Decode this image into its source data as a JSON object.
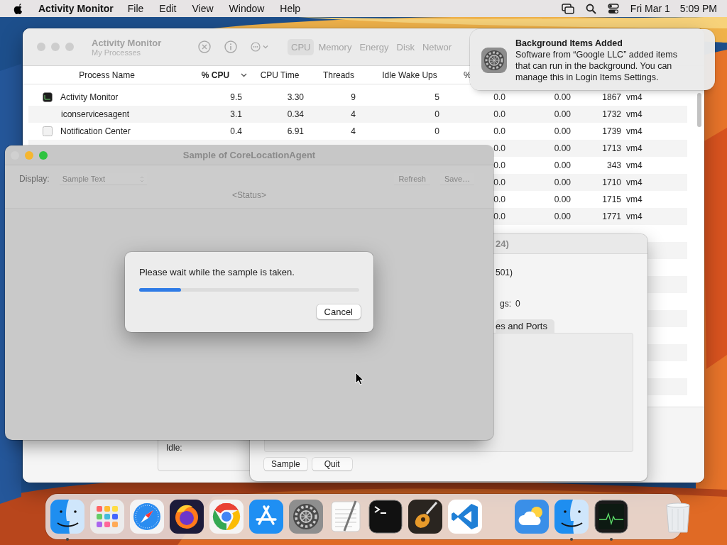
{
  "menu_bar": {
    "app_name": "Activity Monitor",
    "menus": [
      "File",
      "Edit",
      "View",
      "Window",
      "Help"
    ],
    "date": "Fri Mar 1",
    "time": "5:09 PM"
  },
  "activity_monitor": {
    "title": "Activity Monitor",
    "subtitle": "My Processes",
    "tabs": [
      {
        "label": "CPU",
        "selected": true
      },
      {
        "label": "Memory",
        "selected": false
      },
      {
        "label": "Energy",
        "selected": false
      },
      {
        "label": "Disk",
        "selected": false
      },
      {
        "label": "Networ",
        "selected": false
      }
    ],
    "columns": [
      {
        "label": "Process Name",
        "sorted": false
      },
      {
        "label": "% CPU",
        "sorted": true
      },
      {
        "label": "CPU Time",
        "sorted": false
      },
      {
        "label": "Threads",
        "sorted": false
      },
      {
        "label": "Idle Wake Ups",
        "sorted": false
      },
      {
        "label": "%",
        "sorted": false
      }
    ],
    "rows": [
      {
        "process_name": "Activity Monitor",
        "cpu": "9.5",
        "cpu_time": "3.30",
        "threads": "9",
        "idle_wake_ups": "5",
        "column_6": "0.0",
        "column_7": "0.00",
        "column_8": "1867",
        "column_9": "vm4"
      },
      {
        "process_name": "iconservicesagent",
        "cpu": "3.1",
        "cpu_time": "0.34",
        "threads": "4",
        "idle_wake_ups": "0",
        "column_6": "0.0",
        "column_7": "0.00",
        "column_8": "1732",
        "column_9": "vm4"
      },
      {
        "process_name": "Notification Center",
        "cpu": "0.4",
        "cpu_time": "6.91",
        "threads": "4",
        "idle_wake_ups": "0",
        "column_6": "0.0",
        "column_7": "0.00",
        "column_8": "1739",
        "column_9": "vm4"
      },
      {
        "column_6": "0.0",
        "column_7": "0.00",
        "column_8": "1713",
        "column_9": "vm4"
      },
      {
        "column_6": "0.0",
        "column_7": "0.00",
        "column_8": "343",
        "column_9": "vm4"
      },
      {
        "column_6": "0.0",
        "column_7": "0.00",
        "column_8": "1710",
        "column_9": "vm4"
      },
      {
        "column_6": "0.0",
        "column_7": "0.00",
        "column_8": "1715",
        "column_9": "vm4"
      },
      {
        "column_6": "0.0",
        "column_7": "0.00",
        "column_8": "1771",
        "column_9": "vm4"
      }
    ]
  },
  "back_panel": {
    "label": "Idle:"
  },
  "process_inspector": {
    "title": "24)",
    "user": "501)",
    "field_label": "gs:",
    "field_value": "0",
    "tab": "es and Ports",
    "buttons": [
      "Sample",
      "Quit"
    ]
  },
  "sample_window": {
    "title": "Sample of CoreLocationAgent",
    "display_label": "Display:",
    "display_value": "Sample Text",
    "buttons": [
      {
        "label": "Refresh",
        "disabled": true
      },
      {
        "label": "Save…",
        "disabled": true
      }
    ],
    "status": "<Status>",
    "sheet": {
      "message": "Please wait while the sample is taken.",
      "level": 0.19,
      "button": "Cancel"
    }
  },
  "notification": {
    "title": "Background Items Added",
    "lines": [
      "Software from “Google LLC” added items",
      "that can run in the background. You can",
      "manage this in Login Items Settings."
    ]
  },
  "dock": {
    "items": [
      {
        "kind": "finder",
        "running": true
      },
      {
        "kind": "launchpad",
        "running": false
      },
      {
        "kind": "safari",
        "running": false
      },
      {
        "kind": "firefox",
        "running": false
      },
      {
        "kind": "chrome",
        "running": false
      },
      {
        "kind": "appstore",
        "running": false
      },
      {
        "kind": "settings",
        "running": false
      },
      {
        "kind": "textedit",
        "running": false
      },
      {
        "kind": "terminal",
        "running": false
      },
      {
        "kind": "garageband",
        "running": false
      },
      {
        "kind": "vscode",
        "running": false
      },
      {
        "kind": "separator"
      },
      {
        "kind": "weather",
        "running": false
      },
      {
        "kind": "finder",
        "running": true
      },
      {
        "kind": "monitor",
        "running": true
      },
      {
        "kind": "separator"
      },
      {
        "kind": "trash",
        "running": false
      }
    ]
  }
}
